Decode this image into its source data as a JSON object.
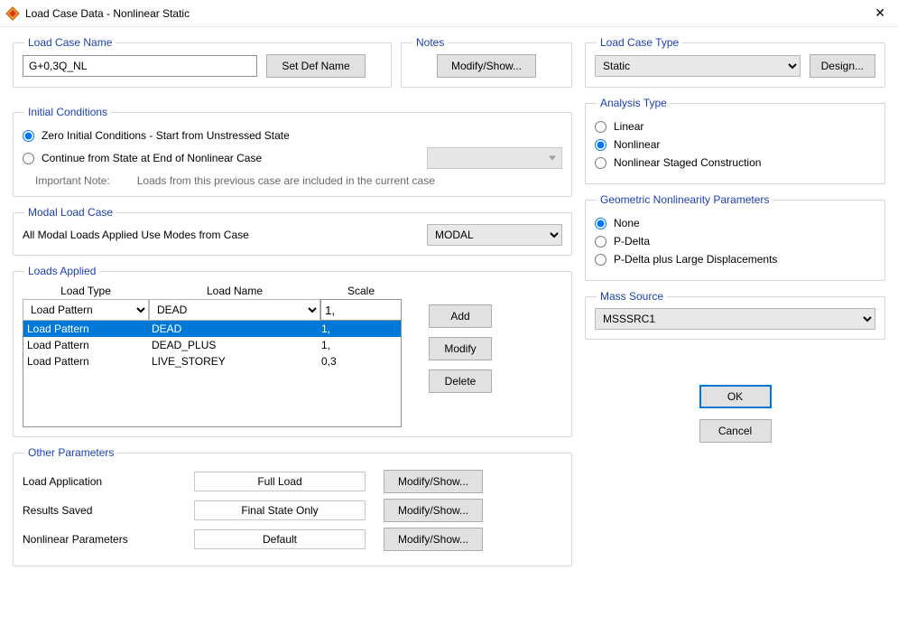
{
  "window": {
    "title": "Load Case Data - Nonlinear Static"
  },
  "left": {
    "name_group": {
      "legend": "Load Case Name",
      "value": "G+0,3Q_NL",
      "set_def_btn": "Set Def Name"
    },
    "notes_group": {
      "legend": "Notes",
      "modify_btn": "Modify/Show..."
    },
    "initial_conditions": {
      "legend": "Initial Conditions",
      "zero": "Zero Initial Conditions - Start from Unstressed State",
      "continue": "Continue from State at End of Nonlinear Case",
      "important_label": "Important Note:",
      "important_text": "Loads from this previous case are included in the current case"
    },
    "modal_group": {
      "legend": "Modal Load Case",
      "label": "All Modal Loads Applied Use Modes from Case",
      "value": "MODAL"
    },
    "loads_applied": {
      "legend": "Loads Applied",
      "headers": {
        "type": "Load Type",
        "name": "Load Name",
        "scale": "Scale"
      },
      "inputs": {
        "type": "Load Pattern",
        "name": "DEAD",
        "scale": "1,"
      },
      "rows": [
        {
          "type": "Load Pattern",
          "name": "DEAD",
          "scale": "1,"
        },
        {
          "type": "Load Pattern",
          "name": "DEAD_PLUS",
          "scale": "1,"
        },
        {
          "type": "Load Pattern",
          "name": "LIVE_STOREY",
          "scale": "0,3"
        }
      ],
      "buttons": {
        "add": "Add",
        "modify": "Modify",
        "delete": "Delete"
      }
    },
    "other_params": {
      "legend": "Other Parameters",
      "rows": [
        {
          "label": "Load Application",
          "value": "Full Load",
          "btn": "Modify/Show..."
        },
        {
          "label": "Results Saved",
          "value": "Final State Only",
          "btn": "Modify/Show..."
        },
        {
          "label": "Nonlinear Parameters",
          "value": "Default",
          "btn": "Modify/Show..."
        }
      ]
    }
  },
  "right": {
    "case_type": {
      "legend": "Load Case Type",
      "value": "Static",
      "design_btn": "Design..."
    },
    "analysis_type": {
      "legend": "Analysis Type",
      "linear": "Linear",
      "nonlinear": "Nonlinear",
      "staged": "Nonlinear Staged Construction"
    },
    "geom": {
      "legend": "Geometric Nonlinearity Parameters",
      "none": "None",
      "pdelta": "P-Delta",
      "pdelta_large": "P-Delta plus Large Displacements"
    },
    "mass": {
      "legend": "Mass Source",
      "value": "MSSSRC1"
    },
    "actions": {
      "ok": "OK",
      "cancel": "Cancel"
    }
  }
}
